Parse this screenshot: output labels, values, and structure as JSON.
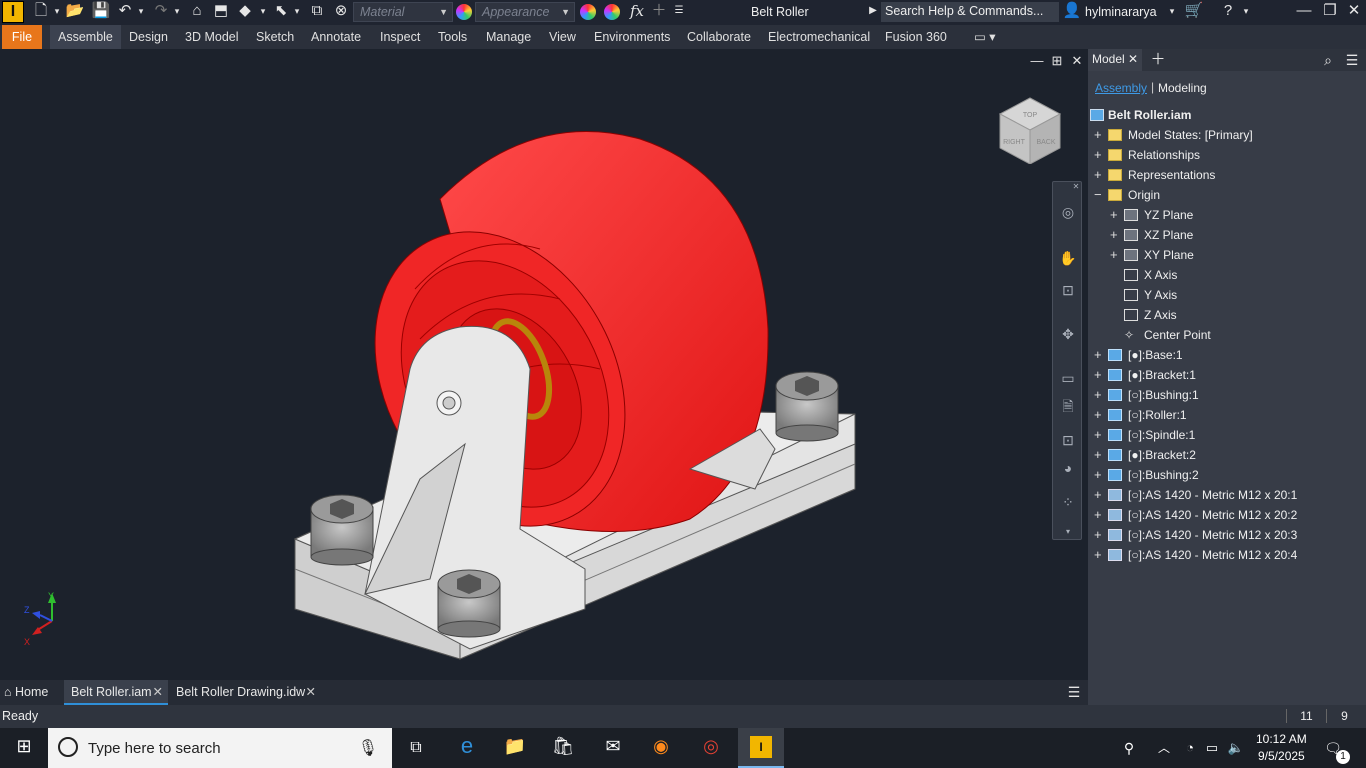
{
  "app": {
    "title": "Belt Roller",
    "logo_letter": "I"
  },
  "titlebar": {
    "material_placeholder": "Material",
    "appearance_placeholder": "Appearance",
    "search_placeholder": "Search Help & Commands...",
    "user": "hylminararya",
    "fx": "fx"
  },
  "menu": {
    "items": [
      "File",
      "Assemble",
      "Design",
      "3D Model",
      "Sketch",
      "Annotate",
      "Inspect",
      "Tools",
      "Manage",
      "View",
      "Environments",
      "Collaborate",
      "Electromechanical",
      "Fusion 360"
    ],
    "active": "Assemble"
  },
  "browser": {
    "tab_label": "Model",
    "subtabs": [
      "Assembly",
      "Modeling"
    ],
    "root": "Belt Roller.iam",
    "items": [
      {
        "label": "Model States: [Primary]",
        "indent": 0,
        "expander": "+",
        "icon": "folder"
      },
      {
        "label": "Relationships",
        "indent": 0,
        "expander": "+",
        "icon": "folder"
      },
      {
        "label": "Representations",
        "indent": 0,
        "expander": "+",
        "icon": "representations"
      },
      {
        "label": "Origin",
        "indent": 0,
        "expander": "−",
        "icon": "folder-open"
      },
      {
        "label": "YZ Plane",
        "indent": 1,
        "expander": "+",
        "icon": "plane"
      },
      {
        "label": "XZ Plane",
        "indent": 1,
        "expander": "+",
        "icon": "plane"
      },
      {
        "label": "XY Plane",
        "indent": 1,
        "expander": "+",
        "icon": "plane"
      },
      {
        "label": "X Axis",
        "indent": 1,
        "expander": "",
        "icon": "axis"
      },
      {
        "label": "Y Axis",
        "indent": 1,
        "expander": "",
        "icon": "axis"
      },
      {
        "label": "Z Axis",
        "indent": 1,
        "expander": "",
        "icon": "axis"
      },
      {
        "label": "Center Point",
        "indent": 1,
        "expander": "",
        "icon": "point"
      },
      {
        "label": "[●]:Base:1",
        "indent": 0,
        "expander": "+",
        "icon": "part"
      },
      {
        "label": "[●]:Bracket:1",
        "indent": 0,
        "expander": "+",
        "icon": "part"
      },
      {
        "label": "[○]:Bushing:1",
        "indent": 0,
        "expander": "+",
        "icon": "part"
      },
      {
        "label": "[○]:Roller:1",
        "indent": 0,
        "expander": "+",
        "icon": "part"
      },
      {
        "label": "[○]:Spindle:1",
        "indent": 0,
        "expander": "+",
        "icon": "part"
      },
      {
        "label": "[●]:Bracket:2",
        "indent": 0,
        "expander": "+",
        "icon": "part"
      },
      {
        "label": "[○]:Bushing:2",
        "indent": 0,
        "expander": "+",
        "icon": "part"
      },
      {
        "label": "[○]:AS 1420 - Metric M12 x 20:1",
        "indent": 0,
        "expander": "+",
        "icon": "fastener"
      },
      {
        "label": "[○]:AS 1420 - Metric M12 x 20:2",
        "indent": 0,
        "expander": "+",
        "icon": "fastener"
      },
      {
        "label": "[○]:AS 1420 - Metric M12 x 20:3",
        "indent": 0,
        "expander": "+",
        "icon": "fastener"
      },
      {
        "label": "[○]:AS 1420 - Metric M12 x 20:4",
        "indent": 0,
        "expander": "+",
        "icon": "fastener"
      }
    ]
  },
  "viewcube": {
    "face_right": "RIGHT",
    "face_back": "BACK",
    "face_top": "TOP"
  },
  "triad": {
    "x": "X",
    "y": "Y",
    "z": "Z"
  },
  "doctabs": {
    "home": "Home",
    "tab1": "Belt Roller.iam",
    "tab2": "Belt Roller Drawing.idw"
  },
  "status": {
    "text": "Ready",
    "count1": "11",
    "count2": "9"
  },
  "taskbar": {
    "search_placeholder": "Type here to search",
    "time": "10:12 AM",
    "date": "9/5/2025",
    "notification_count": "1"
  },
  "colors": {
    "accent": "#e8761b",
    "roller": "#f02020",
    "selection": "#2f8fd8",
    "part_blue": "#5aa9e6"
  }
}
